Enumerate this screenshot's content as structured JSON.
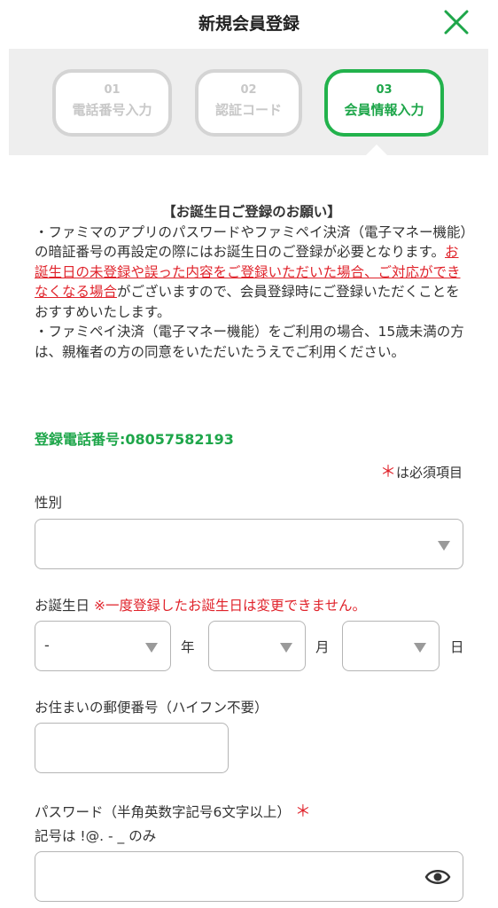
{
  "header": {
    "title": "新規会員登録"
  },
  "steps": [
    {
      "num": "01",
      "label": "電話番号入力"
    },
    {
      "num": "02",
      "label": "認証コード"
    },
    {
      "num": "03",
      "label": "会員情報入力"
    }
  ],
  "colors": {
    "accent": "#1ea64a",
    "alert": "#e0232b"
  },
  "notice": {
    "title": "【お誕生日ご登録のお願い】",
    "line1": "・ファミマのアプリのパスワードやファミペイ決済（電子マネー機能）の暗証番号の再設定の際にはお誕生日のご登録が必要となります。",
    "red": "お誕生日の未登録や誤った内容をご登録いただいた場合、ご対応ができなくなる場合",
    "line2": "がございますので、会員登録時にご登録いただくことをおすすめいたします。",
    "line3": "・ファミペイ決済（電子マネー機能）をご利用の場合、15歳未満の方は、親権者の方の同意をいただいたうえでご利用ください。"
  },
  "phone": {
    "text": "登録電話番号:08057582193"
  },
  "required_note": {
    "star": "＊",
    "text": "は必須項目"
  },
  "gender": {
    "label": "性別",
    "value": ""
  },
  "birthday": {
    "label": "お誕生日",
    "warning": "※一度登録したお誕生日は変更できません。",
    "year_value": "-",
    "year_unit": "年",
    "month_unit": "月",
    "day_unit": "日"
  },
  "postal": {
    "label": "お住まいの郵便番号（ハイフン不要）"
  },
  "password": {
    "label": "パスワード（半角英数字記号6文字以上）",
    "star": "＊",
    "hint": "記号は !@. - _ のみ"
  }
}
